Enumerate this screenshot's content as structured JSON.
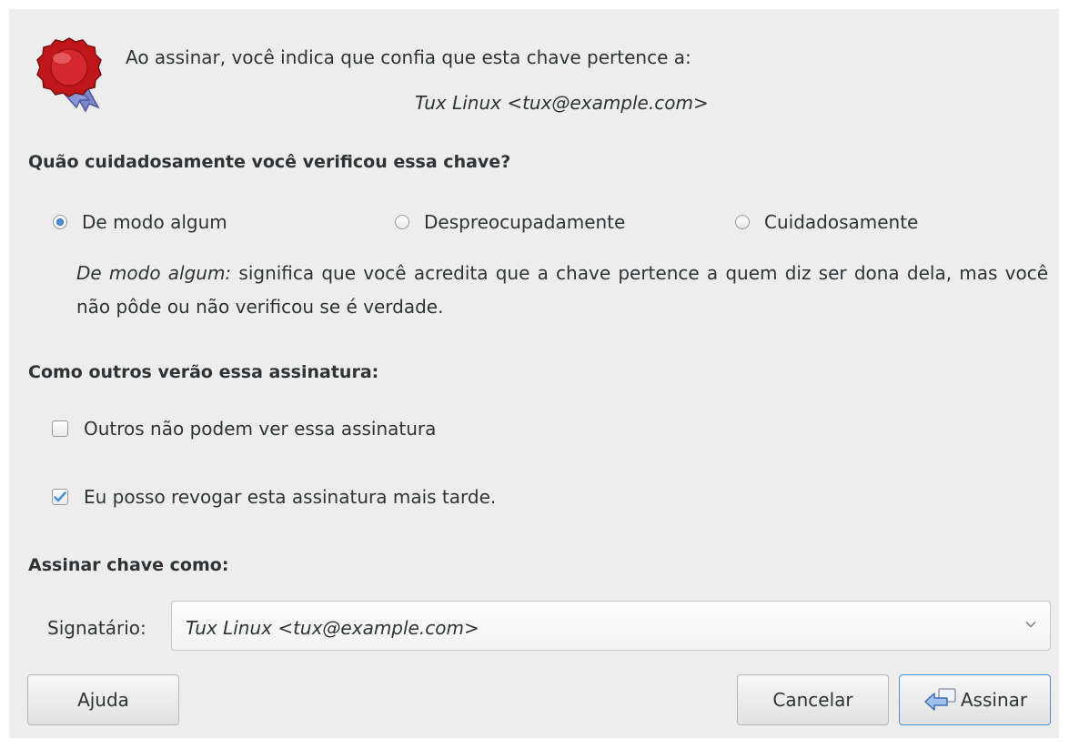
{
  "header": {
    "intro_text": "Ao assinar, você indica que confia que esta chave pertence a:",
    "key_identity": "Tux Linux <tux@example.com>",
    "seal_icon": "seal-icon"
  },
  "verification": {
    "title": "Quão cuidadosamente você verificou essa chave?",
    "options": [
      {
        "label": "De modo algum",
        "selected": true
      },
      {
        "label": "Despreocupadamente",
        "selected": false
      },
      {
        "label": "Cuidadosamente",
        "selected": false
      }
    ],
    "description_term": "De modo algum:",
    "description_text": " significa que você acredita que a chave pertence a quem diz ser dona dela, mas você não pôde ou não verificou se é verdade."
  },
  "visibility": {
    "title": "Como outros verão essa assinatura:",
    "options": [
      {
        "label": "Outros não podem ver essa assinatura",
        "checked": false
      },
      {
        "label": "Eu posso revogar esta assinatura mais tarde.",
        "checked": true
      }
    ]
  },
  "signer": {
    "title": "Assinar chave como:",
    "label": "Signatário:",
    "value": "Tux Linux <tux@example.com>"
  },
  "buttons": {
    "help": "Ajuda",
    "cancel": "Cancelar",
    "sign": "Assinar"
  },
  "colors": {
    "accent": "#4a90d9",
    "seal_red": "#c0171b",
    "background": "#ededed"
  }
}
